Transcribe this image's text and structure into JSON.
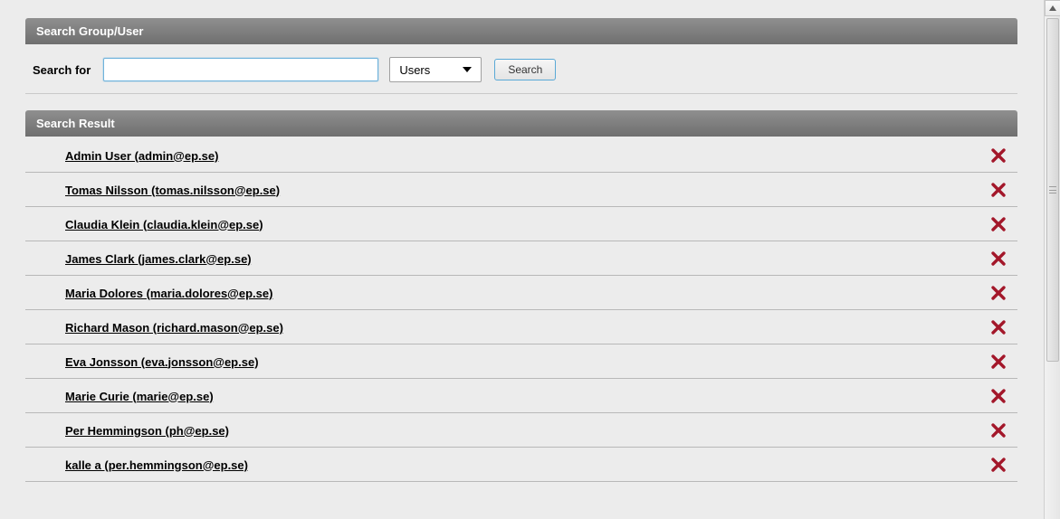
{
  "searchPanel": {
    "title": "Search Group/User",
    "label": "Search for",
    "inputValue": "",
    "selectValue": "Users",
    "buttonLabel": "Search"
  },
  "resultPanel": {
    "title": "Search Result",
    "rows": [
      {
        "label": "Admin User (admin@ep.se)"
      },
      {
        "label": "Tomas Nilsson (tomas.nilsson@ep.se)"
      },
      {
        "label": "Claudia Klein (claudia.klein@ep.se)"
      },
      {
        "label": "James Clark (james.clark@ep.se)"
      },
      {
        "label": "Maria Dolores (maria.dolores@ep.se)"
      },
      {
        "label": "Richard Mason (richard.mason@ep.se)"
      },
      {
        "label": "Eva Jonsson (eva.jonsson@ep.se)"
      },
      {
        "label": "Marie Curie (marie@ep.se)"
      },
      {
        "label": "Per Hemmingson (ph@ep.se)"
      },
      {
        "label": "kalle a (per.hemmingson@ep.se)"
      }
    ]
  }
}
